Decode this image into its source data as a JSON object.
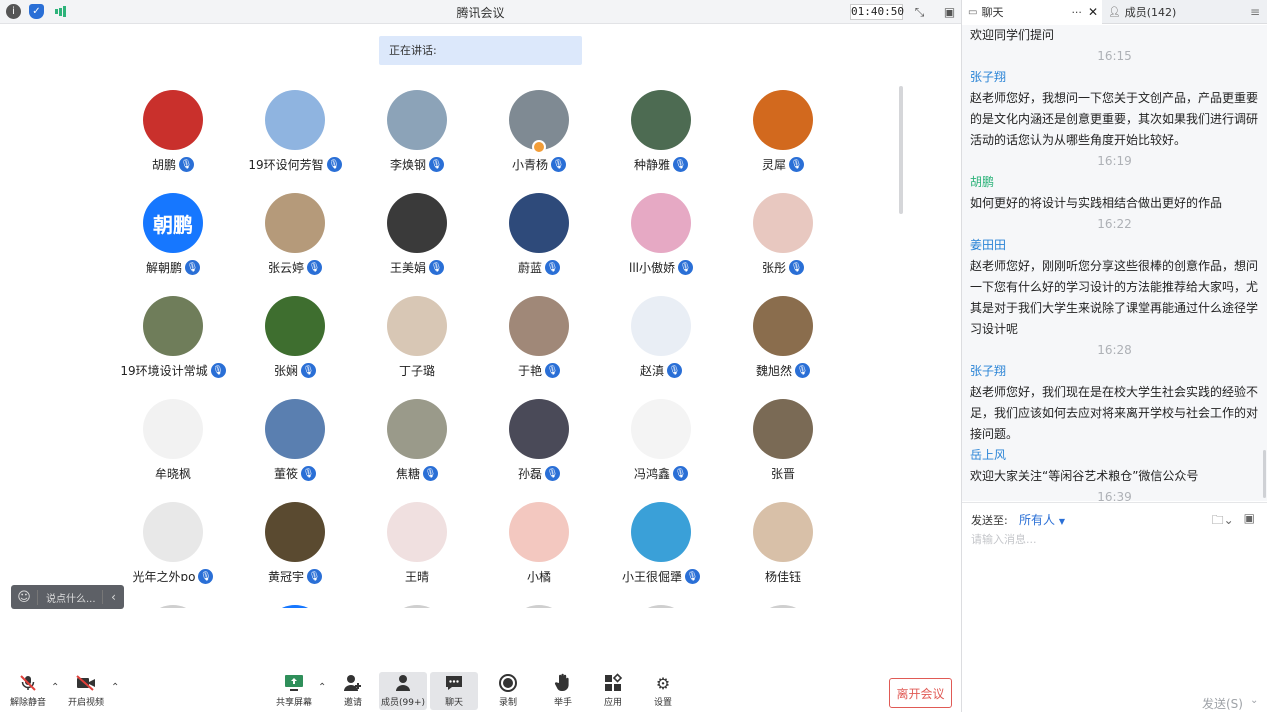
{
  "window": {
    "title": "腾讯会议",
    "timer": "01:40:50"
  },
  "speaking": {
    "label": "正在讲话:"
  },
  "participants": [
    {
      "name": "胡鹏",
      "mic": true,
      "color": "#c9302c"
    },
    {
      "name": "19环设何芳智",
      "mic": true,
      "color": "#8fb4e0"
    },
    {
      "name": "李焕钢",
      "mic": true,
      "color": "#8ca3b8"
    },
    {
      "name": "小青杨",
      "mic": true,
      "color": "#7f8a93",
      "host": true
    },
    {
      "name": "种静雅",
      "mic": true,
      "color": "#4d6b52"
    },
    {
      "name": "灵犀",
      "mic": true,
      "color": "#d2691e"
    },
    {
      "name": "解朝鹏",
      "mic": true,
      "color": "#1677ff",
      "initials": "朝鹏"
    },
    {
      "name": "张云婷",
      "mic": true,
      "color": "#b59a7a"
    },
    {
      "name": "王美娟",
      "mic": true,
      "color": "#3a3a3a"
    },
    {
      "name": "蔚蓝",
      "mic": true,
      "color": "#2e4a7a"
    },
    {
      "name": "lll小傲娇",
      "mic": true,
      "color": "#e6a9c4"
    },
    {
      "name": "张彤",
      "mic": true,
      "color": "#e8c8c0"
    },
    {
      "name": "19环境设计常城",
      "mic": true,
      "color": "#6f7d5a"
    },
    {
      "name": "张娴",
      "mic": true,
      "color": "#3e6e2f"
    },
    {
      "name": "丁子璐",
      "mic": false,
      "color": "#d8c7b5"
    },
    {
      "name": "于艳",
      "mic": true,
      "color": "#a08878"
    },
    {
      "name": "赵滇",
      "mic": true,
      "color": "#e9eef5"
    },
    {
      "name": "魏旭然",
      "mic": true,
      "color": "#8a6d4d"
    },
    {
      "name": "牟晓枫",
      "mic": false,
      "color": "#f2f2f2"
    },
    {
      "name": "董筱",
      "mic": true,
      "color": "#5a7fb0"
    },
    {
      "name": "焦糖",
      "mic": true,
      "color": "#9a9a8a"
    },
    {
      "name": "孙磊",
      "mic": true,
      "color": "#4a4a58"
    },
    {
      "name": "冯鸿鑫",
      "mic": true,
      "color": "#f4f4f4"
    },
    {
      "name": "张晋",
      "mic": false,
      "color": "#7a6a55"
    },
    {
      "name": "光年之外ɒo",
      "mic": true,
      "color": "#e8e8e8"
    },
    {
      "name": "黄冠宇",
      "mic": true,
      "color": "#5a4a30"
    },
    {
      "name": "王晴",
      "mic": false,
      "color": "#f0e0e0"
    },
    {
      "name": "小橘",
      "mic": false,
      "color": "#f3c8c0"
    },
    {
      "name": "小王很倔犟",
      "mic": true,
      "color": "#3aa0d8"
    },
    {
      "name": "杨佳钰",
      "mic": false,
      "color": "#d8c0a8"
    }
  ],
  "comment": {
    "placeholder": "说点什么..."
  },
  "toolbar": {
    "unmute": "解除静音",
    "video": "开启视频",
    "share": "共享屏幕",
    "invite": "邀请",
    "members": "成员(99+)",
    "chat": "聊天",
    "record": "录制",
    "raise": "举手",
    "apps": "应用",
    "settings": "设置",
    "leave": "离开会议"
  },
  "panel": {
    "chat_tab": "聊天",
    "members_tab": "成员(142)"
  },
  "messages": [
    {
      "kind": "text",
      "text": "欢迎同学们提问"
    },
    {
      "kind": "time",
      "text": "16:15"
    },
    {
      "kind": "sender",
      "text": "张子翔",
      "color": "#2a84d6"
    },
    {
      "kind": "text",
      "text": "赵老师您好，我想问一下您关于文创产品，产品更重要的是文化内涵还是创意更重要，其次如果我们进行调研活动的话您认为从哪些角度开始比较好。"
    },
    {
      "kind": "time",
      "text": "16:19"
    },
    {
      "kind": "sender",
      "text": "胡鹏",
      "color": "#2db37a"
    },
    {
      "kind": "text",
      "text": "如何更好的将设计与实践相结合做出更好的作品"
    },
    {
      "kind": "time",
      "text": "16:22"
    },
    {
      "kind": "sender",
      "text": "姜田田",
      "color": "#2a84d6"
    },
    {
      "kind": "text",
      "text": "赵老师您好，刚刚听您分享这些很棒的创意作品，想问一下您有什么好的学习设计的方法能推荐给大家吗，尤其是对于我们大学生来说除了课堂再能通过什么途径学习设计呢"
    },
    {
      "kind": "time",
      "text": "16:28"
    },
    {
      "kind": "sender",
      "text": "张子翔",
      "color": "#2a84d6"
    },
    {
      "kind": "text",
      "text": "赵老师您好，我们现在是在校大学生社会实践的经验不足，我们应该如何去应对将来离开学校与社会工作的对接问题。"
    },
    {
      "kind": "sender",
      "text": "岳上风",
      "color": "#2a84d6"
    },
    {
      "kind": "text",
      "text": "欢迎大家关注“等闲谷艺术粮仓”微信公众号"
    },
    {
      "kind": "time",
      "text": "16:39"
    }
  ],
  "compose": {
    "send_to_label": "发送至:",
    "target": "所有人",
    "placeholder": "请输入消息...",
    "send": "发送(S)"
  }
}
